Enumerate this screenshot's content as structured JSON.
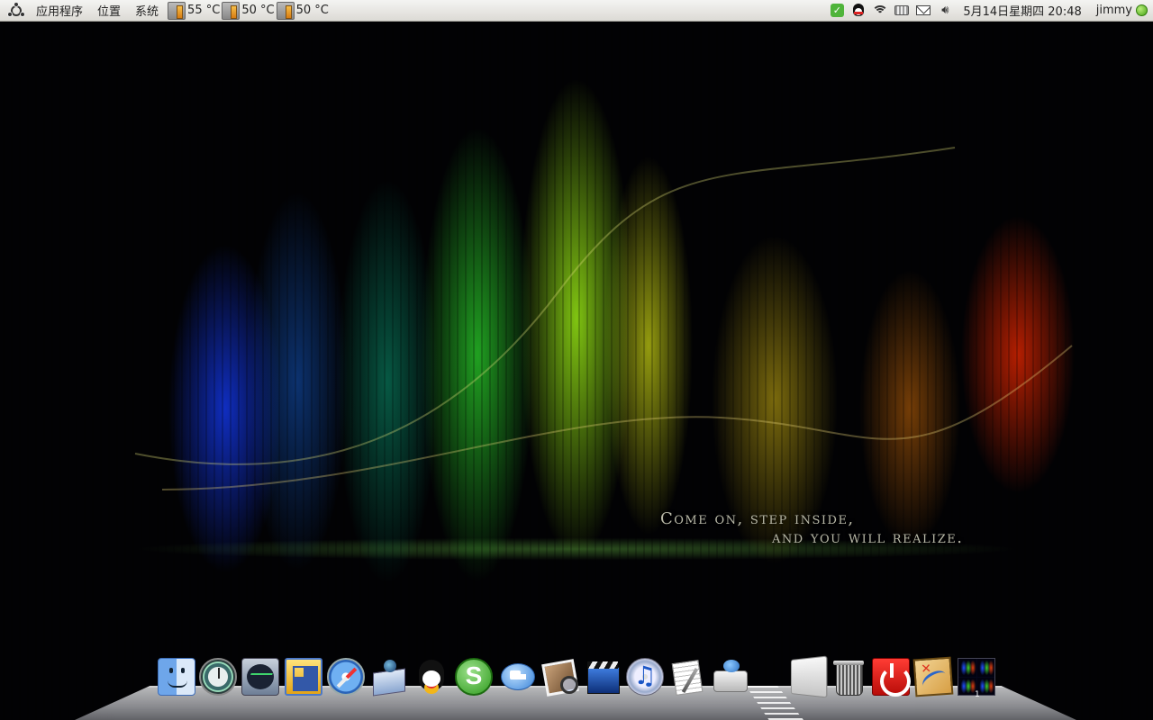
{
  "top_panel": {
    "menus": [
      "应用程序",
      "位置",
      "系统"
    ],
    "temperatures": [
      "55 °C",
      "50 °C",
      "50 °C"
    ],
    "tray_icons": [
      "im-status-icon",
      "qq-icon",
      "wifi-icon",
      "keyboard-icon",
      "mail-icon",
      "volume-icon"
    ],
    "clock": "5月14日星期四 20:48",
    "username": "jimmy",
    "status_color": "#46a316"
  },
  "wallpaper": {
    "line1": "Come on, step inside,",
    "line2": "and you will realize."
  },
  "dock": {
    "icons": [
      "finder-icon",
      "time-machine-icon",
      "activity-monitor-icon",
      "expose-icon",
      "safari-icon",
      "mail-app-icon",
      "qq-app-icon",
      "skype-icon",
      "ichat-icon",
      "iphoto-icon",
      "imovie-icon",
      "itunes-icon",
      "textedit-icon",
      "printer-icon",
      "folder-icon",
      "trash-icon",
      "shutdown-icon",
      "map-icon",
      "workspace-switcher-icon"
    ],
    "workspace_number": "1"
  }
}
